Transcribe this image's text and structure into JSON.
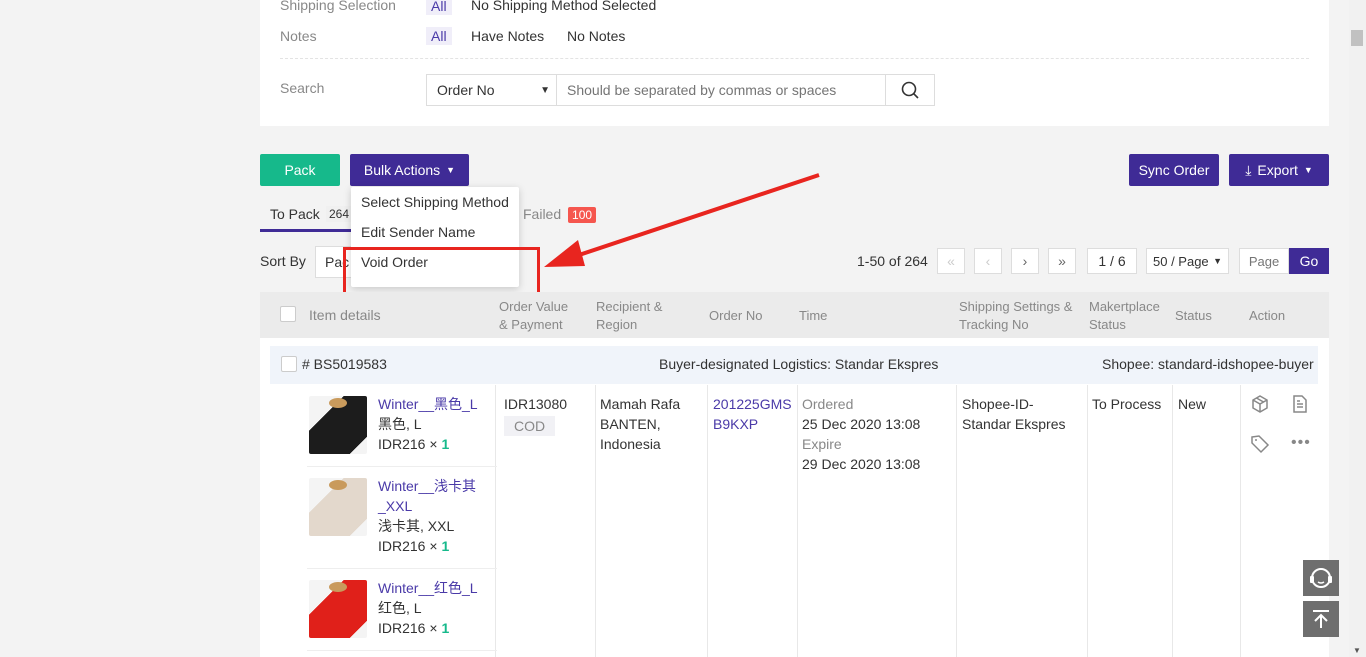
{
  "filters": {
    "shipping_selection": {
      "label": "Shipping Selection",
      "options": [
        "All",
        "No Shipping Method Selected"
      ],
      "selected": "All"
    },
    "notes": {
      "label": "Notes",
      "options": [
        "All",
        "Have Notes",
        "No Notes"
      ],
      "selected": "All"
    },
    "search": {
      "label": "Search",
      "field": "Order No",
      "placeholder": "Should be separated by commas or spaces"
    }
  },
  "toolbar": {
    "pack": "Pack",
    "bulk_actions": "Bulk Actions",
    "sync_order": "Sync Order",
    "export": "Export"
  },
  "bulk_menu": [
    "Select Shipping Method",
    "Edit Sender Name",
    "Void Order"
  ],
  "tabs": [
    {
      "label": "To Pack",
      "count": "264"
    },
    {
      "label": "Failed",
      "count": "100"
    }
  ],
  "sort": {
    "label": "Sort By",
    "value": "Pac"
  },
  "pagination": {
    "range": "1-50 of 264",
    "first": "«",
    "prev": "‹",
    "next": "›",
    "last": "»",
    "current": "1 / 6",
    "per_page": "50 / Page",
    "page_placeholder": "Page",
    "go": "Go"
  },
  "table": {
    "headers": [
      "Item details",
      "Order Value & Payment",
      "Recipient & Region",
      "Order No",
      "Time",
      "Shipping Settings & Tracking No",
      "Makertplace Status",
      "Status",
      "Action"
    ],
    "order": {
      "id": "# BS5019583",
      "logistics": "Buyer-designated Logistics: Standar Ekspres",
      "shop": "Shopee: standard-idshopee-buyer",
      "items": [
        {
          "name": "Winter__黑色_L",
          "variant": "黑色, L",
          "price": "IDR216",
          "times": "×",
          "qty": "1",
          "color": "#1c1c1c"
        },
        {
          "name": "Winter__浅卡其_XXL",
          "variant": "浅卡其, XXL",
          "price": "IDR216",
          "times": "×",
          "qty": "1",
          "color": "#e3d8cc"
        },
        {
          "name": "Winter__红色_L",
          "variant": "红色, L",
          "price": "IDR216",
          "times": "×",
          "qty": "1",
          "color": "#e0201a"
        }
      ],
      "value": "IDR13080",
      "payment": "COD",
      "recipient": [
        "Mamah Rafa",
        "BANTEN,",
        "Indonesia"
      ],
      "order_no": [
        "201225GMS",
        "B9KXP"
      ],
      "time": {
        "ordered_label": "Ordered",
        "ordered": "25 Dec 2020 13:08",
        "expire_label": "Expire",
        "expire": "29 Dec 2020 13:08"
      },
      "shipping": "Shopee-ID-Standar Ekspres",
      "marketplace_status": "To Process",
      "status": "New",
      "actions": [
        "package-icon",
        "document-icon",
        "tag-icon",
        "more-icon"
      ]
    }
  },
  "colors": {
    "accent": "#3f2b96",
    "pack": "#16b98b",
    "failed_badge": "#f5564e",
    "annotation": "#e8251f"
  }
}
